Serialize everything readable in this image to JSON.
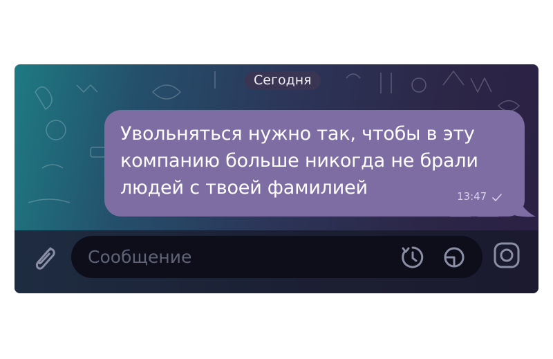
{
  "chat": {
    "date_label": "Сегодня",
    "message": {
      "lines": [
        "Увольняться нужно так, чтобы в эту",
        "компанию больше никогда не брали",
        "людей с твоей фамилией"
      ],
      "time": "13:47",
      "status_icon": "check-icon"
    }
  },
  "input": {
    "placeholder": "Сообщение",
    "left_icon": "paperclip-icon",
    "right_icons": [
      "timer-icon",
      "sticker-icon",
      "camera-icon"
    ]
  },
  "colors": {
    "bubble": "#7d6da3",
    "input_field": "#0d0e1a",
    "icon": "#8b8fa6"
  }
}
